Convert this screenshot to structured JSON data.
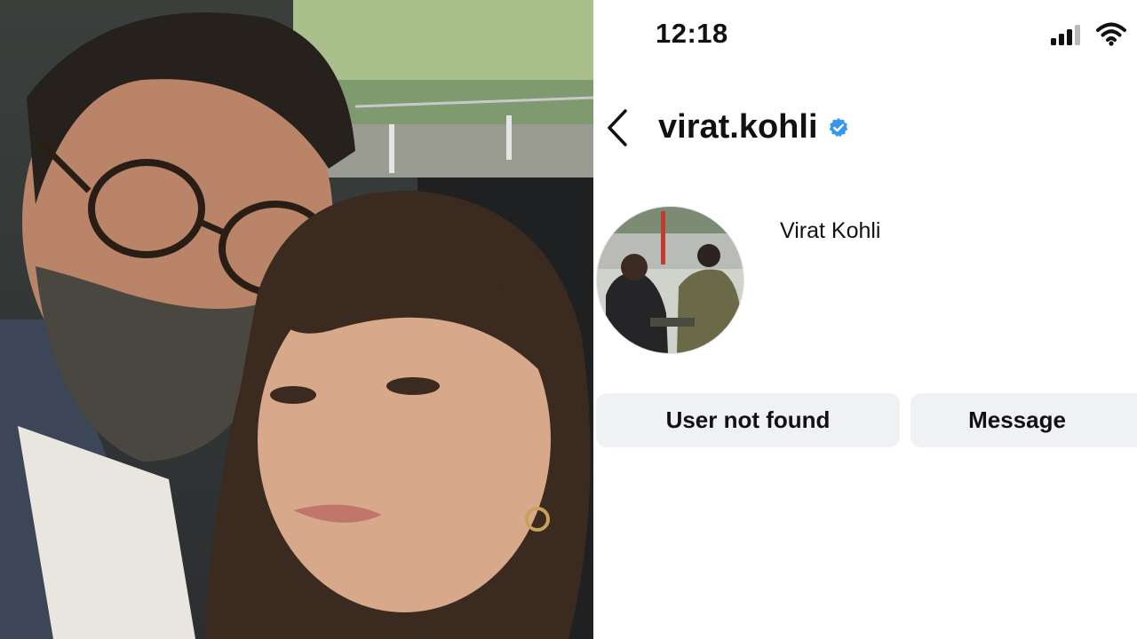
{
  "status_bar": {
    "time": "12:18",
    "signal_icon": "cellular-signal-icon",
    "wifi_icon": "wifi-icon"
  },
  "header": {
    "back_icon": "chevron-left-icon",
    "username": "virat.kohli",
    "verified_icon": "verified-badge-icon"
  },
  "profile": {
    "display_name": "Virat Kohli"
  },
  "actions": {
    "primary_label": "User not found",
    "secondary_label": "Message"
  },
  "colors": {
    "verified": "#3897f0",
    "button_bg": "#eff1f4",
    "text": "#111111"
  }
}
